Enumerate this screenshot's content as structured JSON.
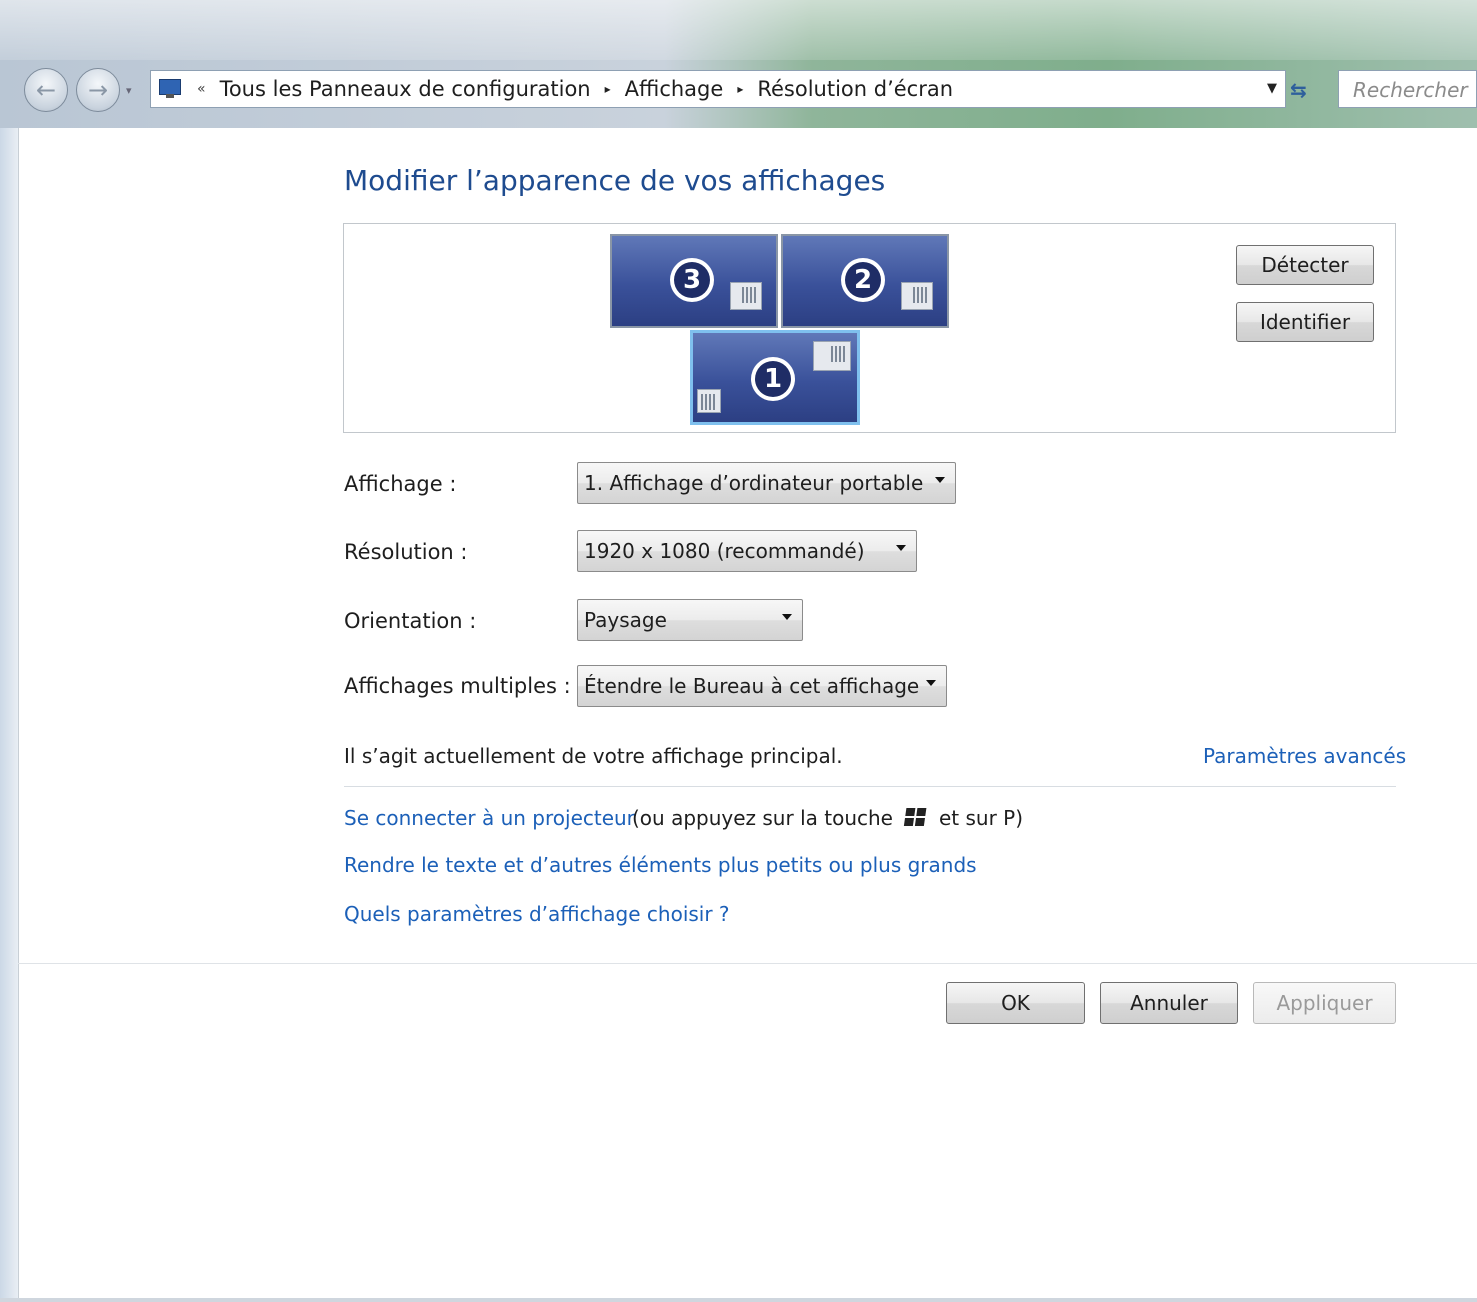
{
  "nav": {
    "back_icon": "back-arrow-icon",
    "forward_icon": "forward-arrow-icon"
  },
  "address": {
    "overflow": "«",
    "breadcrumb": [
      "Tous les Panneaux de configuration",
      "Affichage",
      "Résolution d’écran"
    ],
    "separator": "▸"
  },
  "search": {
    "placeholder": "Rechercher"
  },
  "page": {
    "title": "Modifier l’apparence de vos affichages"
  },
  "monitors": [
    {
      "number": "3"
    },
    {
      "number": "2"
    },
    {
      "number": "1",
      "selected": true
    }
  ],
  "buttons": {
    "detect": "Détecter",
    "identify": "Identifier",
    "ok": "OK",
    "cancel": "Annuler",
    "apply": "Appliquer"
  },
  "settings": {
    "display": {
      "label": "Affichage :",
      "value": "1. Affichage d’ordinateur portable"
    },
    "resolution": {
      "label": "Résolution :",
      "value": "1920 x 1080 (recommandé)"
    },
    "orientation": {
      "label": "Orientation :",
      "value": "Paysage"
    },
    "multiple": {
      "label": "Affichages multiples :",
      "value": "Étendre le Bureau à cet affichage"
    }
  },
  "info": {
    "primary_text": "Il s’agit actuellement de votre affichage principal.",
    "advanced_link": "Paramètres avancés"
  },
  "links": {
    "projector": "Se connecter à un projecteur",
    "projector_hint_a": "(ou appuyez sur la touche",
    "projector_hint_b": "et sur P)",
    "text_size": "Rendre le texte et d’autres éléments plus petits ou plus grands",
    "which_settings": "Quels paramètres d’affichage choisir ?"
  },
  "colors": {
    "title": "#1e4b8f",
    "link": "#1c60b8",
    "monitor": "#3a519a"
  }
}
